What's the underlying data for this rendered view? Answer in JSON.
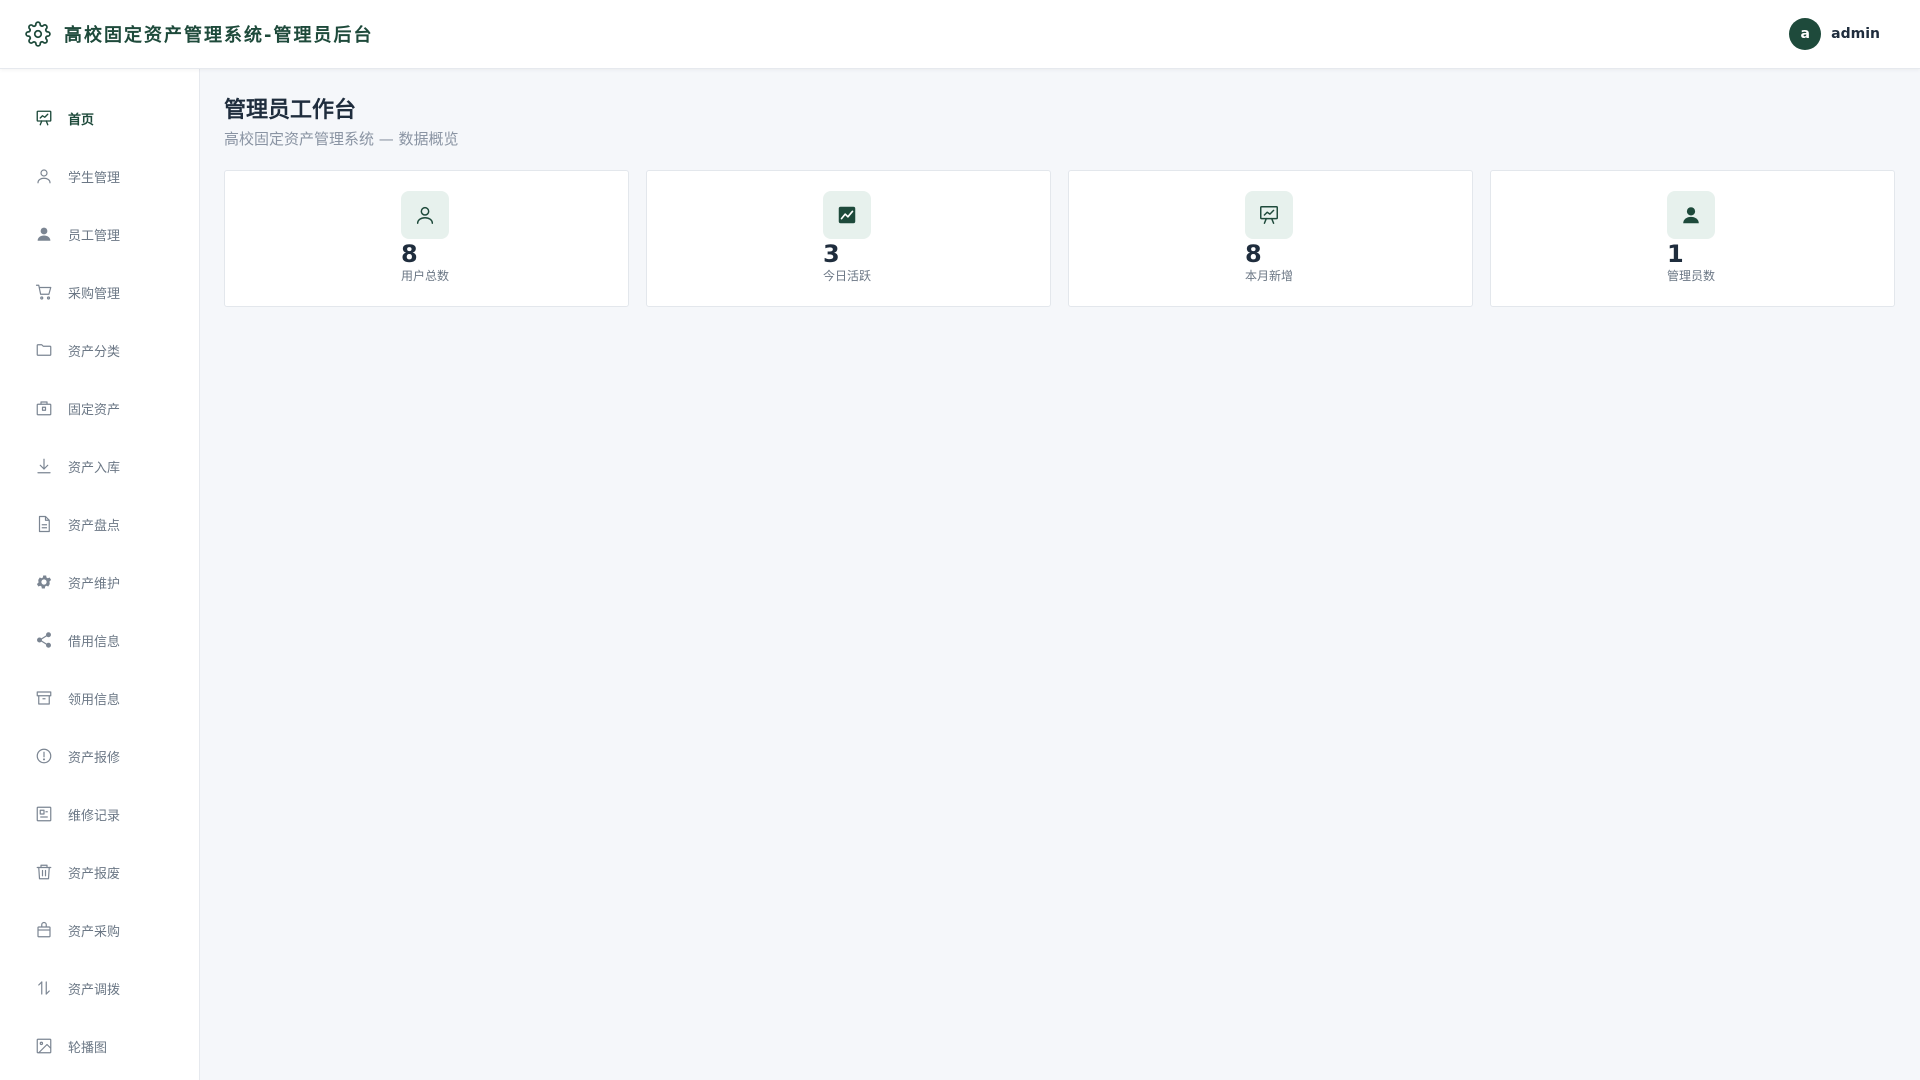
{
  "app": {
    "title": "高校固定资产管理系统-管理员后台",
    "icon": "gear-icon",
    "accent_color": "#1e4a3b"
  },
  "user": {
    "avatar_letter": "a",
    "name": "admin"
  },
  "sidebar": {
    "items": [
      {
        "label": "首页",
        "icon": "presentation-icon",
        "active": true
      },
      {
        "label": "学生管理",
        "icon": "user-outline-icon"
      },
      {
        "label": "员工管理",
        "icon": "user-filled-icon"
      },
      {
        "label": "采购管理",
        "icon": "cart-icon"
      },
      {
        "label": "资产分类",
        "icon": "folder-icon"
      },
      {
        "label": "固定资产",
        "icon": "box-icon"
      },
      {
        "label": "资产入库",
        "icon": "download-icon"
      },
      {
        "label": "资产盘点",
        "icon": "document-icon"
      },
      {
        "label": "资产维护",
        "icon": "gear-filled-icon"
      },
      {
        "label": "借用信息",
        "icon": "share-icon"
      },
      {
        "label": "领用信息",
        "icon": "archive-icon"
      },
      {
        "label": "资产报修",
        "icon": "warning-circle-icon"
      },
      {
        "label": "维修记录",
        "icon": "record-icon"
      },
      {
        "label": "资产报废",
        "icon": "trash-icon"
      },
      {
        "label": "资产采购",
        "icon": "bag-icon"
      },
      {
        "label": "资产调拨",
        "icon": "transfer-icon"
      },
      {
        "label": "轮播图",
        "icon": "image-icon"
      }
    ]
  },
  "main": {
    "title": "管理员工作台",
    "subtitle": "高校固定资产管理系统 — 数据概览"
  },
  "stats": [
    {
      "value": "8",
      "label": "用户总数",
      "icon": "user-outline-icon"
    },
    {
      "value": "3",
      "label": "今日活跃",
      "icon": "trend-chart-icon"
    },
    {
      "value": "8",
      "label": "本月新增",
      "icon": "presentation-icon"
    },
    {
      "value": "1",
      "label": "管理员数",
      "icon": "user-filled-icon"
    }
  ]
}
